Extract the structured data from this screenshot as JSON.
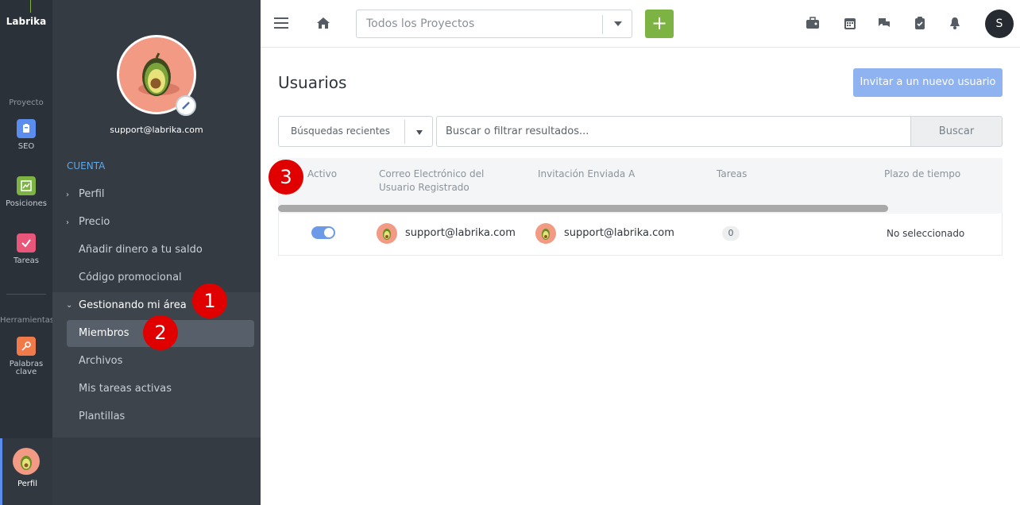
{
  "rail": {
    "logo": "Labrika",
    "group_proyecto": "Proyecto",
    "group_herramientas": "Herramientas",
    "items": [
      {
        "label": "SEO",
        "color": "#5b8def"
      },
      {
        "label": "Posiciones",
        "color": "#7cb342"
      },
      {
        "label": "Tareas",
        "color": "#e8577a"
      },
      {
        "label": "Palabras clave",
        "color": "#f07a4a"
      }
    ],
    "profile_label": "Perfil"
  },
  "sidebar": {
    "email": "support@labrika.com",
    "section": "CUENTA",
    "menu": [
      "Perfil",
      "Precio",
      "Añadir dinero a tu saldo",
      "Código promocional",
      "Gestionando mi área",
      "Miembros",
      "Archivos",
      "Mis tareas activas",
      "Plantillas"
    ]
  },
  "topbar": {
    "project_select": "Todos los Proyectos",
    "add_label": "+",
    "user_initial": "S"
  },
  "main": {
    "title": "Usuarios",
    "invite_button": "Invitar a un nuevo usuario",
    "recent_searches": "Búsquedas recientes",
    "search_placeholder": "Buscar o filtrar resultados...",
    "search_button": "Buscar",
    "columns": [
      "Activo",
      "Correo Electrónico del Usuario Registrado",
      "Invitación Enviada A",
      "Tareas",
      "Plazo de tiempo"
    ],
    "rows": [
      {
        "active": true,
        "email": "support@labrika.com",
        "invited_to": "support@labrika.com",
        "tasks": "0",
        "term": "No seleccionado"
      }
    ]
  },
  "markers": [
    "1",
    "2",
    "3"
  ],
  "colors": {
    "rail_bg": "#2b3138",
    "sidebar_bg": "#343b43",
    "accent_blue": "#5b8def",
    "accent_green": "#7cb342",
    "marker_red": "#e10000"
  }
}
